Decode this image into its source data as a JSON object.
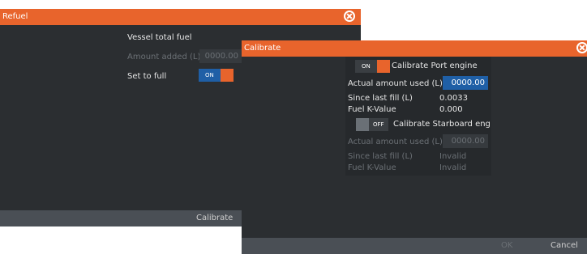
{
  "refuel": {
    "title": "Refuel",
    "vessel_total_fuel_label": "Vessel total fuel",
    "amount_added_label": "Amount added (L)",
    "amount_added_value": "0000.00",
    "set_to_full_label": "Set to full",
    "set_to_full_toggle": "ON",
    "calibrate_button": "Calibrate"
  },
  "calibrate": {
    "title": "Calibrate",
    "port": {
      "toggle_label": "ON",
      "label": "Calibrate Port engine",
      "actual_used_label": "Actual amount used (L)",
      "actual_used_value": "0000.00",
      "since_last_fill_label": "Since last fill (L)",
      "since_last_fill_value": "0.0033",
      "k_value_label": "Fuel K-Value",
      "k_value_value": "0.000"
    },
    "starboard": {
      "toggle_label": "OFF",
      "label": "Calibrate Starboard engine",
      "actual_used_label": "Actual amount used (L)",
      "actual_used_value": "0000.00",
      "since_last_fill_label": "Since last fill (L)",
      "since_last_fill_value": "Invalid",
      "k_value_label": "Fuel K-Value",
      "k_value_value": "Invalid"
    },
    "ok_button": "OK",
    "cancel_button": "Cancel"
  },
  "colors": {
    "accent": "#e8642c",
    "panel_bg": "#2b2e31",
    "toggle_blue": "#1f5fa6",
    "footer_bg": "#4a4f55"
  }
}
